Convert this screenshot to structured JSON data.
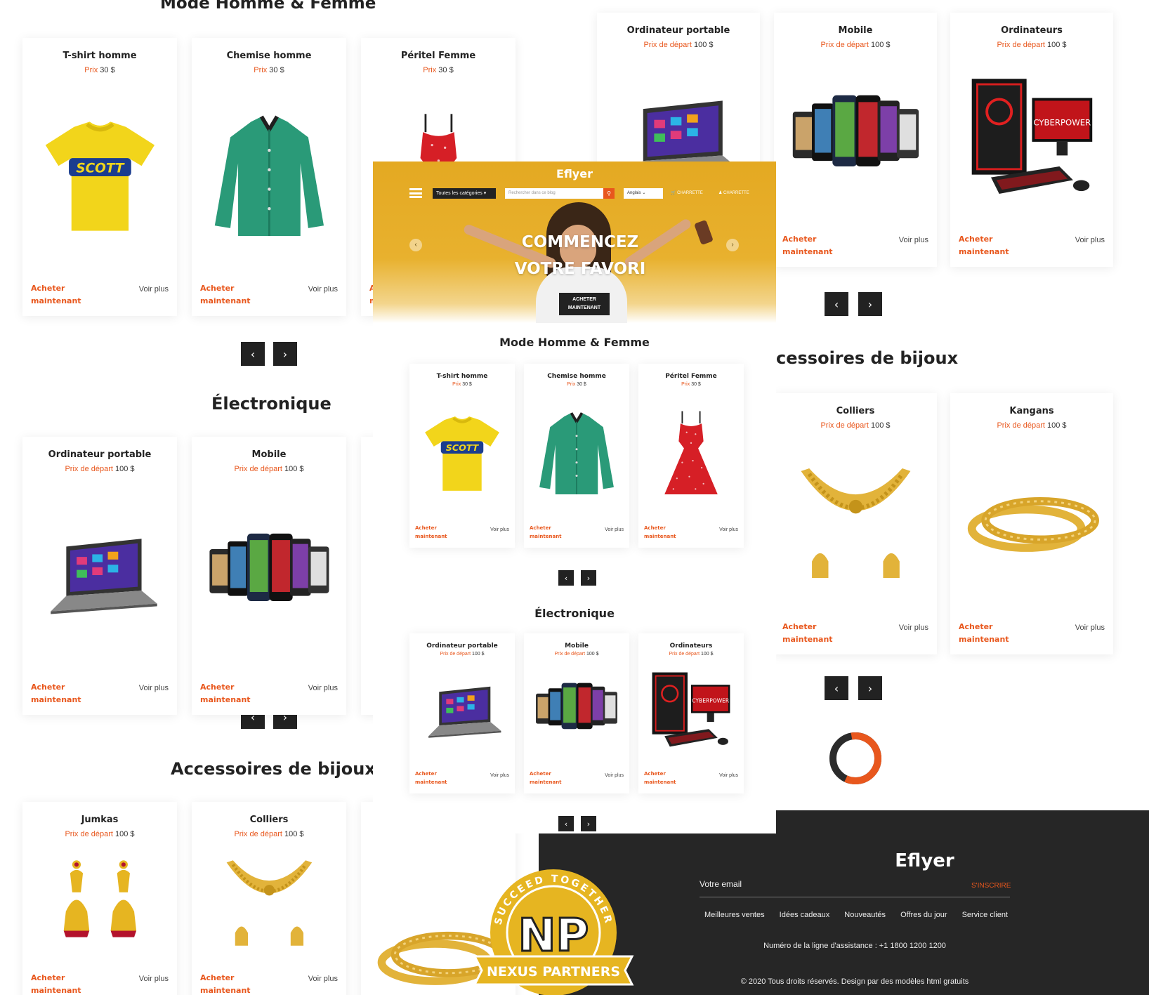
{
  "left_column": {
    "fashion": {
      "title": "Mode Homme & Femme",
      "products": [
        {
          "name": "T-shirt homme",
          "price_label": "Prix",
          "price": "30 $",
          "image": "tshirt-yellow"
        },
        {
          "name": "Chemise homme",
          "price_label": "Prix",
          "price": "30 $",
          "image": "shirt-green"
        },
        {
          "name": "Péritel Femme",
          "price_label": "Prix",
          "price": "30 $",
          "image": "dress-red"
        }
      ]
    },
    "electronics": {
      "title": "Électronique",
      "products": [
        {
          "name": "Ordinateur portable",
          "price_label": "Prix de départ",
          "price": "100 $",
          "image": "laptop"
        },
        {
          "name": "Mobile",
          "price_label": "Prix de départ",
          "price": "100 $",
          "image": "phones"
        }
      ]
    },
    "jewelry": {
      "title": "Accessoires de bijoux",
      "products": [
        {
          "name": "Jumkas",
          "price_label": "Prix de départ",
          "price": "100 $",
          "image": "earrings"
        },
        {
          "name": "Colliers",
          "price_label": "Prix de départ",
          "price": "100 $",
          "image": "necklace"
        }
      ]
    }
  },
  "right_column": {
    "electronics": {
      "products": [
        {
          "name": "Ordinateur portable",
          "price_label": "Prix de départ",
          "price": "100 $",
          "image": "laptop"
        },
        {
          "name": "Mobile",
          "price_label": "Prix de départ",
          "price": "100 $",
          "image": "phones"
        },
        {
          "name": "Ordinateurs",
          "price_label": "Prix de départ",
          "price": "100 $",
          "image": "desktop"
        }
      ]
    },
    "jewelry": {
      "title_fragment": "cessoires de bijoux",
      "products": [
        {
          "name": "Colliers",
          "price_label": "Prix de départ",
          "price": "100 $",
          "image": "necklace"
        },
        {
          "name": "Kangans",
          "price_label": "Prix de départ",
          "price": "100 $",
          "image": "bangles"
        }
      ]
    }
  },
  "card_actions": {
    "buy": "Acheter maintenant",
    "more": "Voir plus"
  },
  "nav": {
    "prev": "‹",
    "next": "›"
  },
  "center": {
    "header": {
      "brand": "Eflyer",
      "categories": "Toutes les catégories ▾",
      "search_placeholder": "Rechercher dans ce blog",
      "language": "Anglais ⌄",
      "cart_label": "CHARRETTE",
      "account_label": "CHARRETTE"
    },
    "hero": {
      "headline": "COMMENCEZ VOTRE FAVORI",
      "cta": "ACHETER MAINTENANT"
    },
    "fashion_title": "Mode Homme & Femme",
    "fashion_products": [
      {
        "name": "T-shirt homme",
        "price_label": "Prix",
        "price": "30 $",
        "image": "tshirt-yellow"
      },
      {
        "name": "Chemise homme",
        "price_label": "Prix",
        "price": "30 $",
        "image": "shirt-green"
      },
      {
        "name": "Péritel Femme",
        "price_label": "Prix",
        "price": "30 $",
        "image": "dress-red"
      }
    ],
    "electronics_title": "Électronique",
    "electronics_products": [
      {
        "name": "Ordinateur portable",
        "price_label": "Prix de départ",
        "price": "100 $",
        "image": "laptop"
      },
      {
        "name": "Mobile",
        "price_label": "Prix de départ",
        "price": "100 $",
        "image": "phones"
      },
      {
        "name": "Ordinateurs",
        "price_label": "Prix de départ",
        "price": "100 $",
        "image": "desktop"
      }
    ]
  },
  "footer": {
    "logo": "Eflyer",
    "email_placeholder": "Votre email",
    "subscribe": "S'INSCRIRE",
    "links": [
      "Meilleures ventes",
      "Idées cadeaux",
      "Nouveautés",
      "Offres du jour",
      "Service client"
    ],
    "helpline": "Numéro de la ligne d'assistance : +1 1800 1200 1200",
    "copyright": "© 2020 Tous droits réservés. Design par des modèles html gratuits"
  },
  "badge": {
    "top_text": "SUCCEED TOGETHER",
    "initials": "NP",
    "banner": "NEXUS PARTNERS"
  },
  "colors": {
    "accent": "#e8571d",
    "hero": "#e4a922",
    "dark": "#262626",
    "gold": "#e6b521"
  }
}
